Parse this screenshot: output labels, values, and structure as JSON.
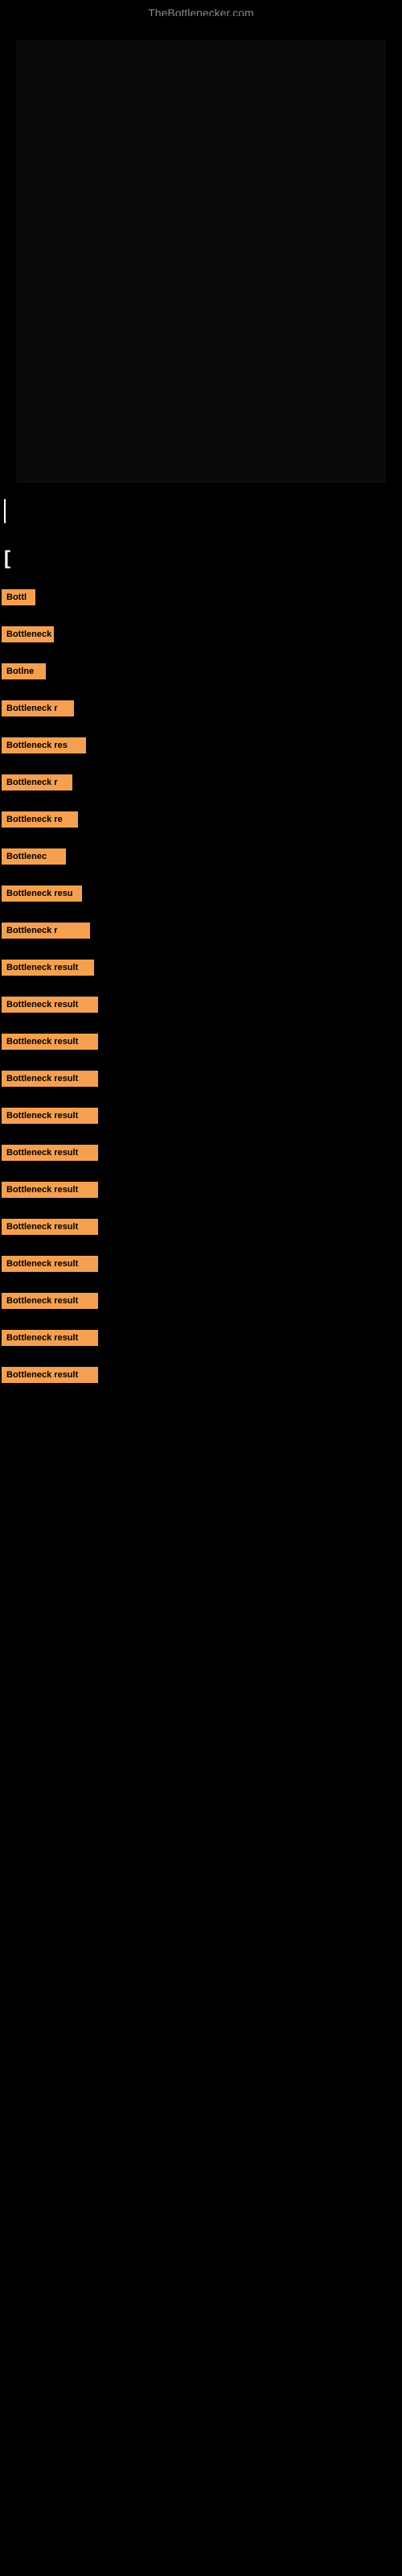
{
  "site": {
    "title": "TheBottlenecker.com"
  },
  "results": [
    {
      "id": 1,
      "label": "Bottl",
      "badgeClass": "badge-w1"
    },
    {
      "id": 2,
      "label": "Bottleneck",
      "badgeClass": "badge-w2"
    },
    {
      "id": 3,
      "label": "Botlne",
      "badgeClass": "badge-w3"
    },
    {
      "id": 4,
      "label": "Bottleneck r",
      "badgeClass": "badge-w4"
    },
    {
      "id": 5,
      "label": "Bottleneck res",
      "badgeClass": "badge-w5"
    },
    {
      "id": 6,
      "label": "Bottleneck r",
      "badgeClass": "badge-w6"
    },
    {
      "id": 7,
      "label": "Bottleneck re",
      "badgeClass": "badge-w7"
    },
    {
      "id": 8,
      "label": "Bottlenec",
      "badgeClass": "badge-w8"
    },
    {
      "id": 9,
      "label": "Bottleneck resu",
      "badgeClass": "badge-w9"
    },
    {
      "id": 10,
      "label": "Bottleneck r",
      "badgeClass": "badge-w10"
    },
    {
      "id": 11,
      "label": "Bottleneck result",
      "badgeClass": "badge-w11"
    },
    {
      "id": 12,
      "label": "Bottleneck result",
      "badgeClass": "badge-w12"
    },
    {
      "id": 13,
      "label": "Bottleneck result",
      "badgeClass": "badge-w13"
    },
    {
      "id": 14,
      "label": "Bottleneck result",
      "badgeClass": "badge-w14"
    },
    {
      "id": 15,
      "label": "Bottleneck result",
      "badgeClass": "badge-w15"
    },
    {
      "id": 16,
      "label": "Bottleneck result",
      "badgeClass": "badge-w16"
    },
    {
      "id": 17,
      "label": "Bottleneck result",
      "badgeClass": "badge-w17"
    },
    {
      "id": 18,
      "label": "Bottleneck result",
      "badgeClass": "badge-w18"
    },
    {
      "id": 19,
      "label": "Bottleneck result",
      "badgeClass": "badge-w19"
    },
    {
      "id": 20,
      "label": "Bottleneck result",
      "badgeClass": "badge-w20"
    },
    {
      "id": 21,
      "label": "Bottleneck result",
      "badgeClass": "badge-w21"
    },
    {
      "id": 22,
      "label": "Bottleneck result",
      "badgeClass": "badge-w22"
    }
  ],
  "colors": {
    "background": "#000000",
    "badge": "#f5a050",
    "text": "#ffffff",
    "siteTitle": "#888888"
  }
}
